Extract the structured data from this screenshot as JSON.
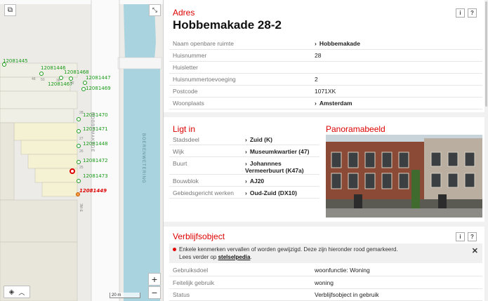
{
  "map": {
    "markers": [
      {
        "label": "12081445"
      },
      {
        "label": "12081446"
      },
      {
        "label": "12081468"
      },
      {
        "label": "12081447"
      },
      {
        "label": "12081467"
      },
      {
        "label": "12081469"
      },
      {
        "label": "12081470"
      },
      {
        "label": "12081471"
      },
      {
        "label": "12081448"
      },
      {
        "label": "12081472"
      },
      {
        "label": "12081473"
      },
      {
        "label": "12081449"
      }
    ],
    "street_labels": [
      "HOBBEMAKADE",
      "BOERENWETERING"
    ],
    "house_numbers": [
      "48",
      "50",
      "52",
      "38",
      "28",
      "27",
      "26",
      "25",
      "3M-E",
      "32"
    ],
    "scale_label": "20 m",
    "zoom_in": "+",
    "zoom_out": "−",
    "icons": {
      "toggle": "map-toggle-icon",
      "fullscreen": "fullscreen-icon",
      "layers": "layers-icon",
      "chevron": "chevron-up-icon"
    }
  },
  "adres": {
    "section_label": "Adres",
    "title": "Hobbemakade 28-2",
    "info_label": "i",
    "help_label": "?",
    "rows": [
      {
        "key": "Naam openbare ruimte",
        "value": "Hobbemakade"
      },
      {
        "key": "Huisnummer",
        "value": "28"
      },
      {
        "key": "Huisletter",
        "value": ""
      },
      {
        "key": "Huisnummertoevoeging",
        "value": "2"
      },
      {
        "key": "Postcode",
        "value": "1071XK"
      },
      {
        "key": "Woonplaats",
        "value": "Amsterdam"
      }
    ]
  },
  "ligt_in": {
    "section_label": "Ligt in",
    "rows": [
      {
        "key": "Stadsdeel",
        "value": "Zuid (K)"
      },
      {
        "key": "Wijk",
        "value": "Museumkwartier (47)"
      },
      {
        "key": "Buurt",
        "value": "Johannnes Vermeerbuurt (K47a)"
      },
      {
        "key": "Bouwblok",
        "value": "AJ20"
      },
      {
        "key": "Gebiedsgericht werken",
        "value": "Oud-Zuid (DX10)"
      }
    ]
  },
  "panorama": {
    "section_label": "Panoramabeeld"
  },
  "verblijfsobject": {
    "section_label": "Verblijfsobject",
    "info_label": "i",
    "help_label": "?",
    "notice_line1": "Enkele kenmerken vervallen of worden gewijzigd. Deze zijn hieronder rood gemarkeerd.",
    "notice_prefix": "Lees verder op ",
    "notice_link": "stelselpedia",
    "notice_suffix": ".",
    "close_label": "✕",
    "rows": [
      {
        "key": "Gebruiksdoel",
        "value": "woonfunctie: Woning"
      },
      {
        "key": "Feitelijk gebruik",
        "value": "woning"
      },
      {
        "key": "Status",
        "value": "Verblijfsobject in gebruik"
      }
    ]
  },
  "colors": {
    "accent": "#d00000",
    "marker_green": "#1a9a1a",
    "water": "#a9d3df"
  }
}
